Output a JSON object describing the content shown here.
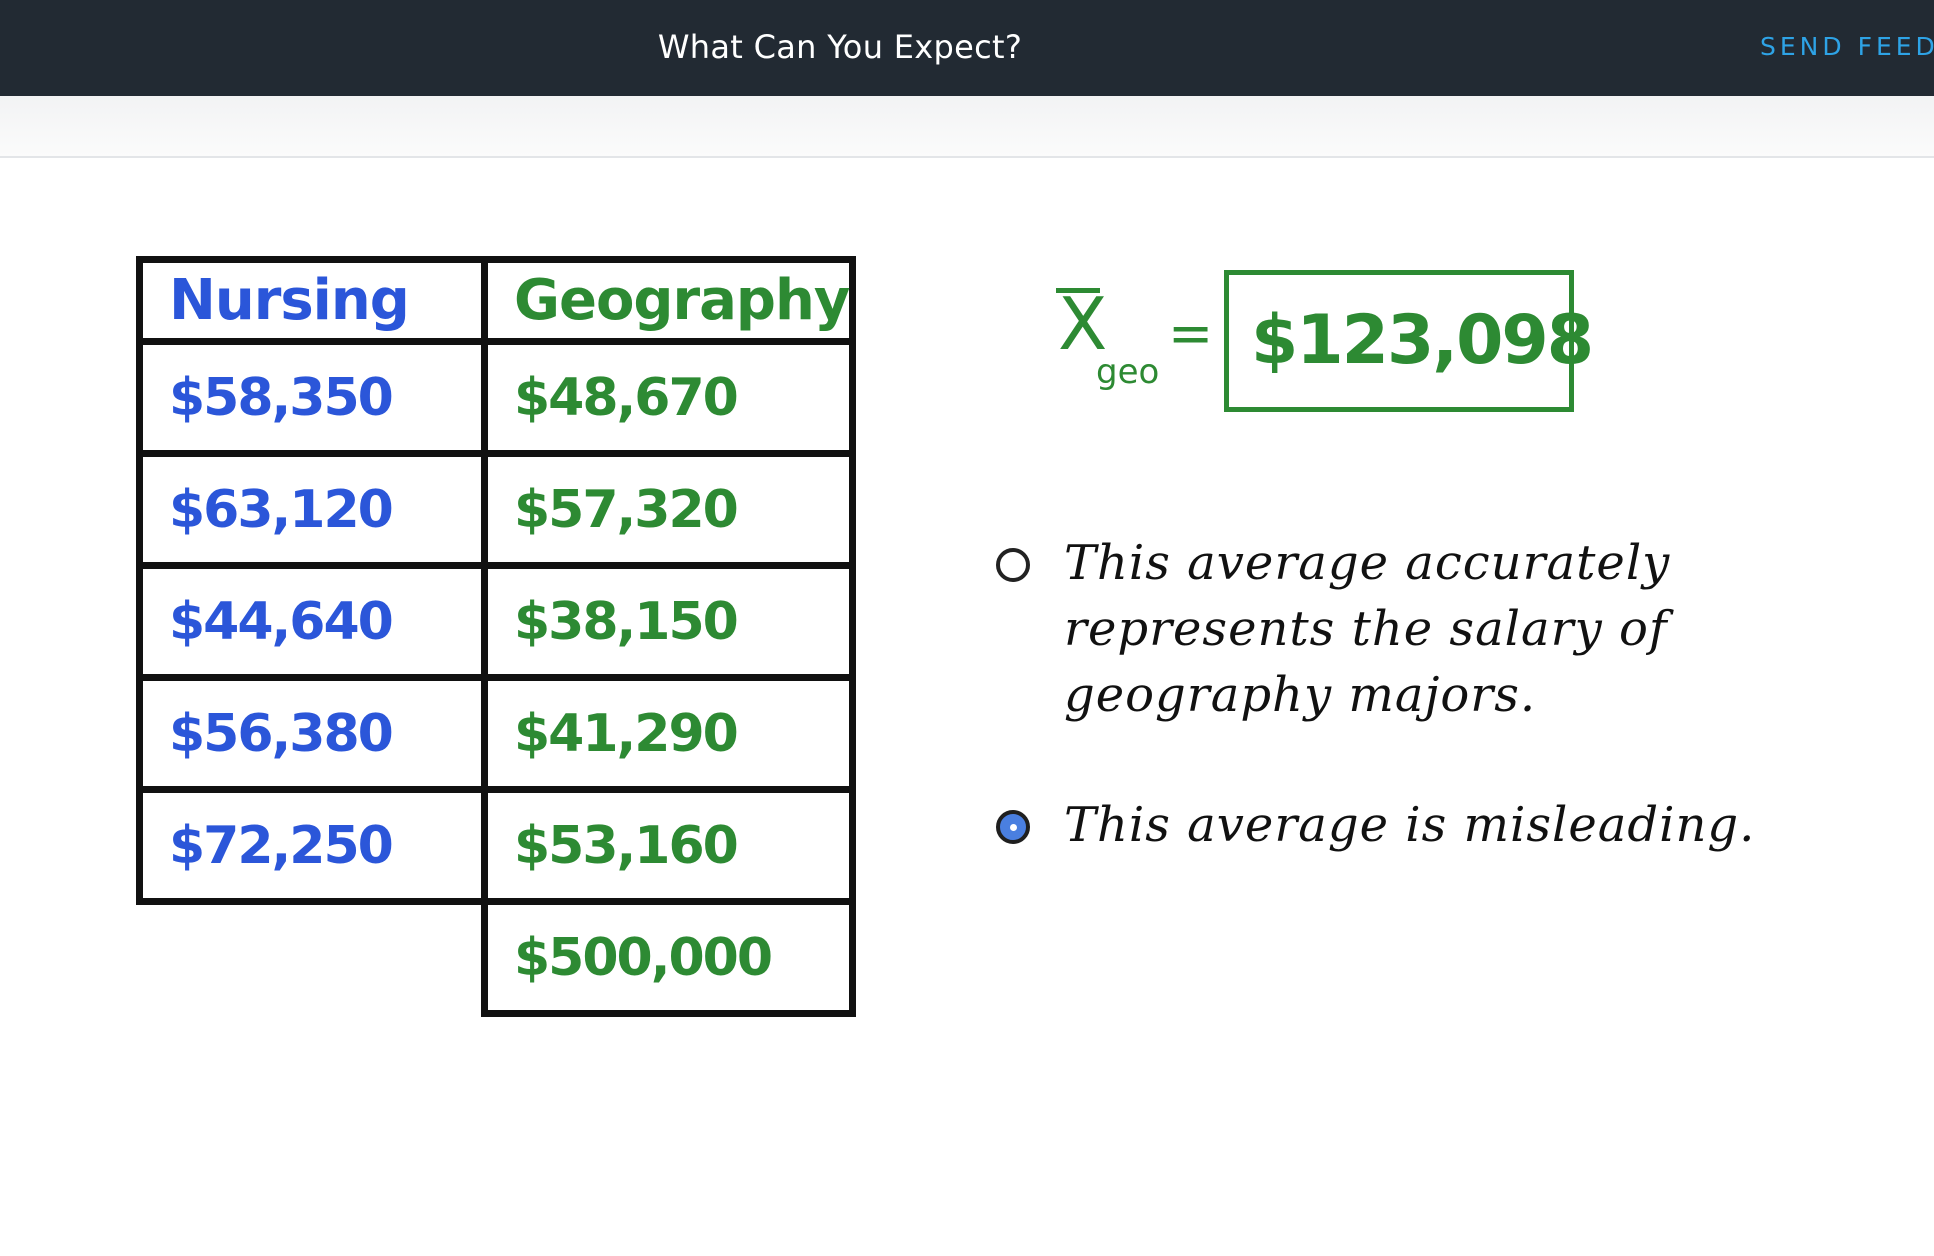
{
  "header": {
    "title": "What Can You Expect?",
    "feedback_label": "SEND FEEDBACK"
  },
  "table": {
    "headers": [
      "Nursing",
      "Geography"
    ],
    "rows": [
      [
        "$58,350",
        "$48,670"
      ],
      [
        "$63,120",
        "$57,320"
      ],
      [
        "$44,640",
        "$38,150"
      ],
      [
        "$56,380",
        "$41,290"
      ],
      [
        "$72,250",
        "$53,160"
      ],
      [
        "",
        "$500,000"
      ]
    ],
    "colors": {
      "nursing": "#2b56d9",
      "geography": "#2d8a33"
    }
  },
  "formula": {
    "symbol": "X",
    "subscript": "geo",
    "equals": "=",
    "value": "$123,098"
  },
  "options": [
    {
      "text": "This average accurately represents the salary of geography majors.",
      "selected": false
    },
    {
      "text": "This average is misleading.",
      "selected": true
    }
  ]
}
